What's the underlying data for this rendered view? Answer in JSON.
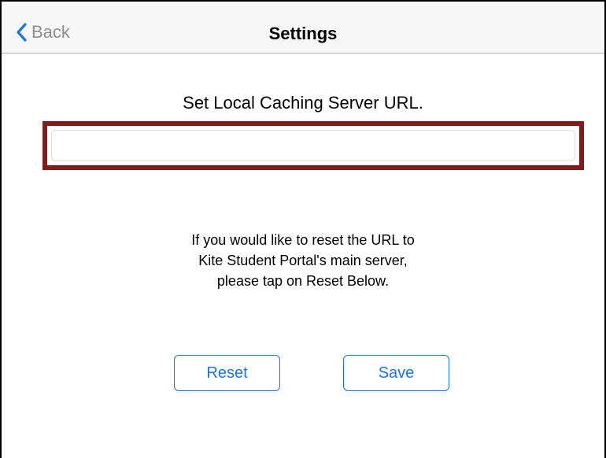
{
  "navbar": {
    "back_label": "Back",
    "title": "Settings",
    "back_icon": "chevron-left-icon"
  },
  "content": {
    "prompt": "Set Local Caching Server URL.",
    "url_input_value": "",
    "url_input_placeholder": "",
    "info_lines": [
      "If you would like to reset the URL to",
      "Kite Student Portal's main server,",
      "please tap on Reset Below."
    ]
  },
  "buttons": {
    "reset_label": "Reset",
    "save_label": "Save"
  },
  "colors": {
    "accent": "#1a73e8",
    "highlight": "#7f1d1d",
    "back_text": "#8e8e93"
  }
}
